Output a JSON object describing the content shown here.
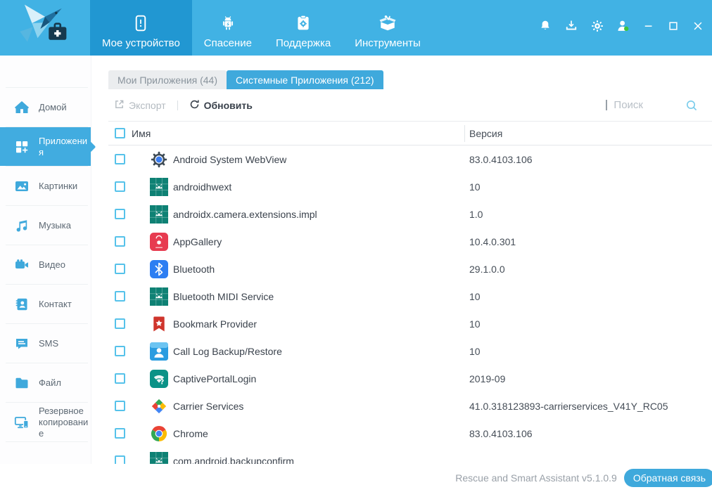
{
  "app": {
    "footer_version": "Rescue and Smart Assistant v5.1.0.9",
    "feedback_label": "Обратная связь"
  },
  "colors": {
    "header": "#41b2e4",
    "header_active_tab": "#2197d2",
    "accent": "#3fa9dc",
    "sidebar_selected": "#41ace0",
    "user_status_online": "#3ec43e"
  },
  "header": {
    "nav": [
      {
        "id": "my-device",
        "label": "Мое устройство",
        "icon": "device-alert",
        "active": true
      },
      {
        "id": "rescue",
        "label": "Спасение",
        "icon": "android-robot",
        "active": false
      },
      {
        "id": "support",
        "label": "Поддержка",
        "icon": "clipboard-gear",
        "active": false
      },
      {
        "id": "tools",
        "label": "Инструменты",
        "icon": "toolbox",
        "active": false
      }
    ],
    "actions": [
      {
        "id": "notifications",
        "icon": "bell"
      },
      {
        "id": "download",
        "icon": "download"
      },
      {
        "id": "settings",
        "icon": "gear"
      },
      {
        "id": "account",
        "icon": "user-online"
      }
    ],
    "window_controls": [
      {
        "id": "minimize",
        "icon": "minimize"
      },
      {
        "id": "maximize",
        "icon": "maximize"
      },
      {
        "id": "close",
        "icon": "close"
      }
    ]
  },
  "sidebar": {
    "items": [
      {
        "label": "Домой",
        "icon": "home",
        "active": false
      },
      {
        "label": "Приложения",
        "icon": "apps",
        "active": true
      },
      {
        "label": "Картинки",
        "icon": "pictures",
        "active": false
      },
      {
        "label": "Музыка",
        "icon": "music",
        "active": false
      },
      {
        "label": "Видео",
        "icon": "video",
        "active": false
      },
      {
        "label": "Контакт",
        "icon": "contact",
        "active": false
      },
      {
        "label": "SMS",
        "icon": "sms",
        "active": false
      },
      {
        "label": "Файл",
        "icon": "folder",
        "active": false
      },
      {
        "label": "Резервное копирование",
        "icon": "backup",
        "active": false
      }
    ]
  },
  "main": {
    "tabs": [
      {
        "label": "Мои Приложения (44)",
        "active": false
      },
      {
        "label": "Системные Приложения (212)",
        "active": true
      }
    ],
    "toolbar": {
      "export_label": "Экспорт",
      "refresh_label": "Обновить",
      "search_placeholder": "Поиск"
    },
    "table": {
      "columns": [
        "Имя",
        "Версия"
      ],
      "rows": [
        {
          "name": "Android System WebView",
          "version": "83.0.4103.106",
          "icon": "webview"
        },
        {
          "name": "androidhwext",
          "version": "10",
          "icon": "android-teal"
        },
        {
          "name": "androidx.camera.extensions.impl",
          "version": "1.0",
          "icon": "android-teal"
        },
        {
          "name": "AppGallery",
          "version": "10.4.0.301",
          "icon": "appgallery"
        },
        {
          "name": "Bluetooth",
          "version": "29.1.0.0",
          "icon": "bluetooth"
        },
        {
          "name": "Bluetooth MIDI Service",
          "version": "10",
          "icon": "android-teal"
        },
        {
          "name": "Bookmark Provider",
          "version": "10",
          "icon": "bookmark"
        },
        {
          "name": "Call Log Backup/Restore",
          "version": "10",
          "icon": "calllog"
        },
        {
          "name": "CaptivePortalLogin",
          "version": "2019-09",
          "icon": "captiveportal"
        },
        {
          "name": "Carrier Services",
          "version": "41.0.318123893-carrierservices_V41Y_RC05",
          "icon": "puzzle"
        },
        {
          "name": "Chrome",
          "version": "83.0.4103.106",
          "icon": "chrome"
        },
        {
          "name": "com.android.backupconfirm",
          "version": "",
          "icon": "android-teal",
          "clipped": true
        }
      ]
    }
  }
}
